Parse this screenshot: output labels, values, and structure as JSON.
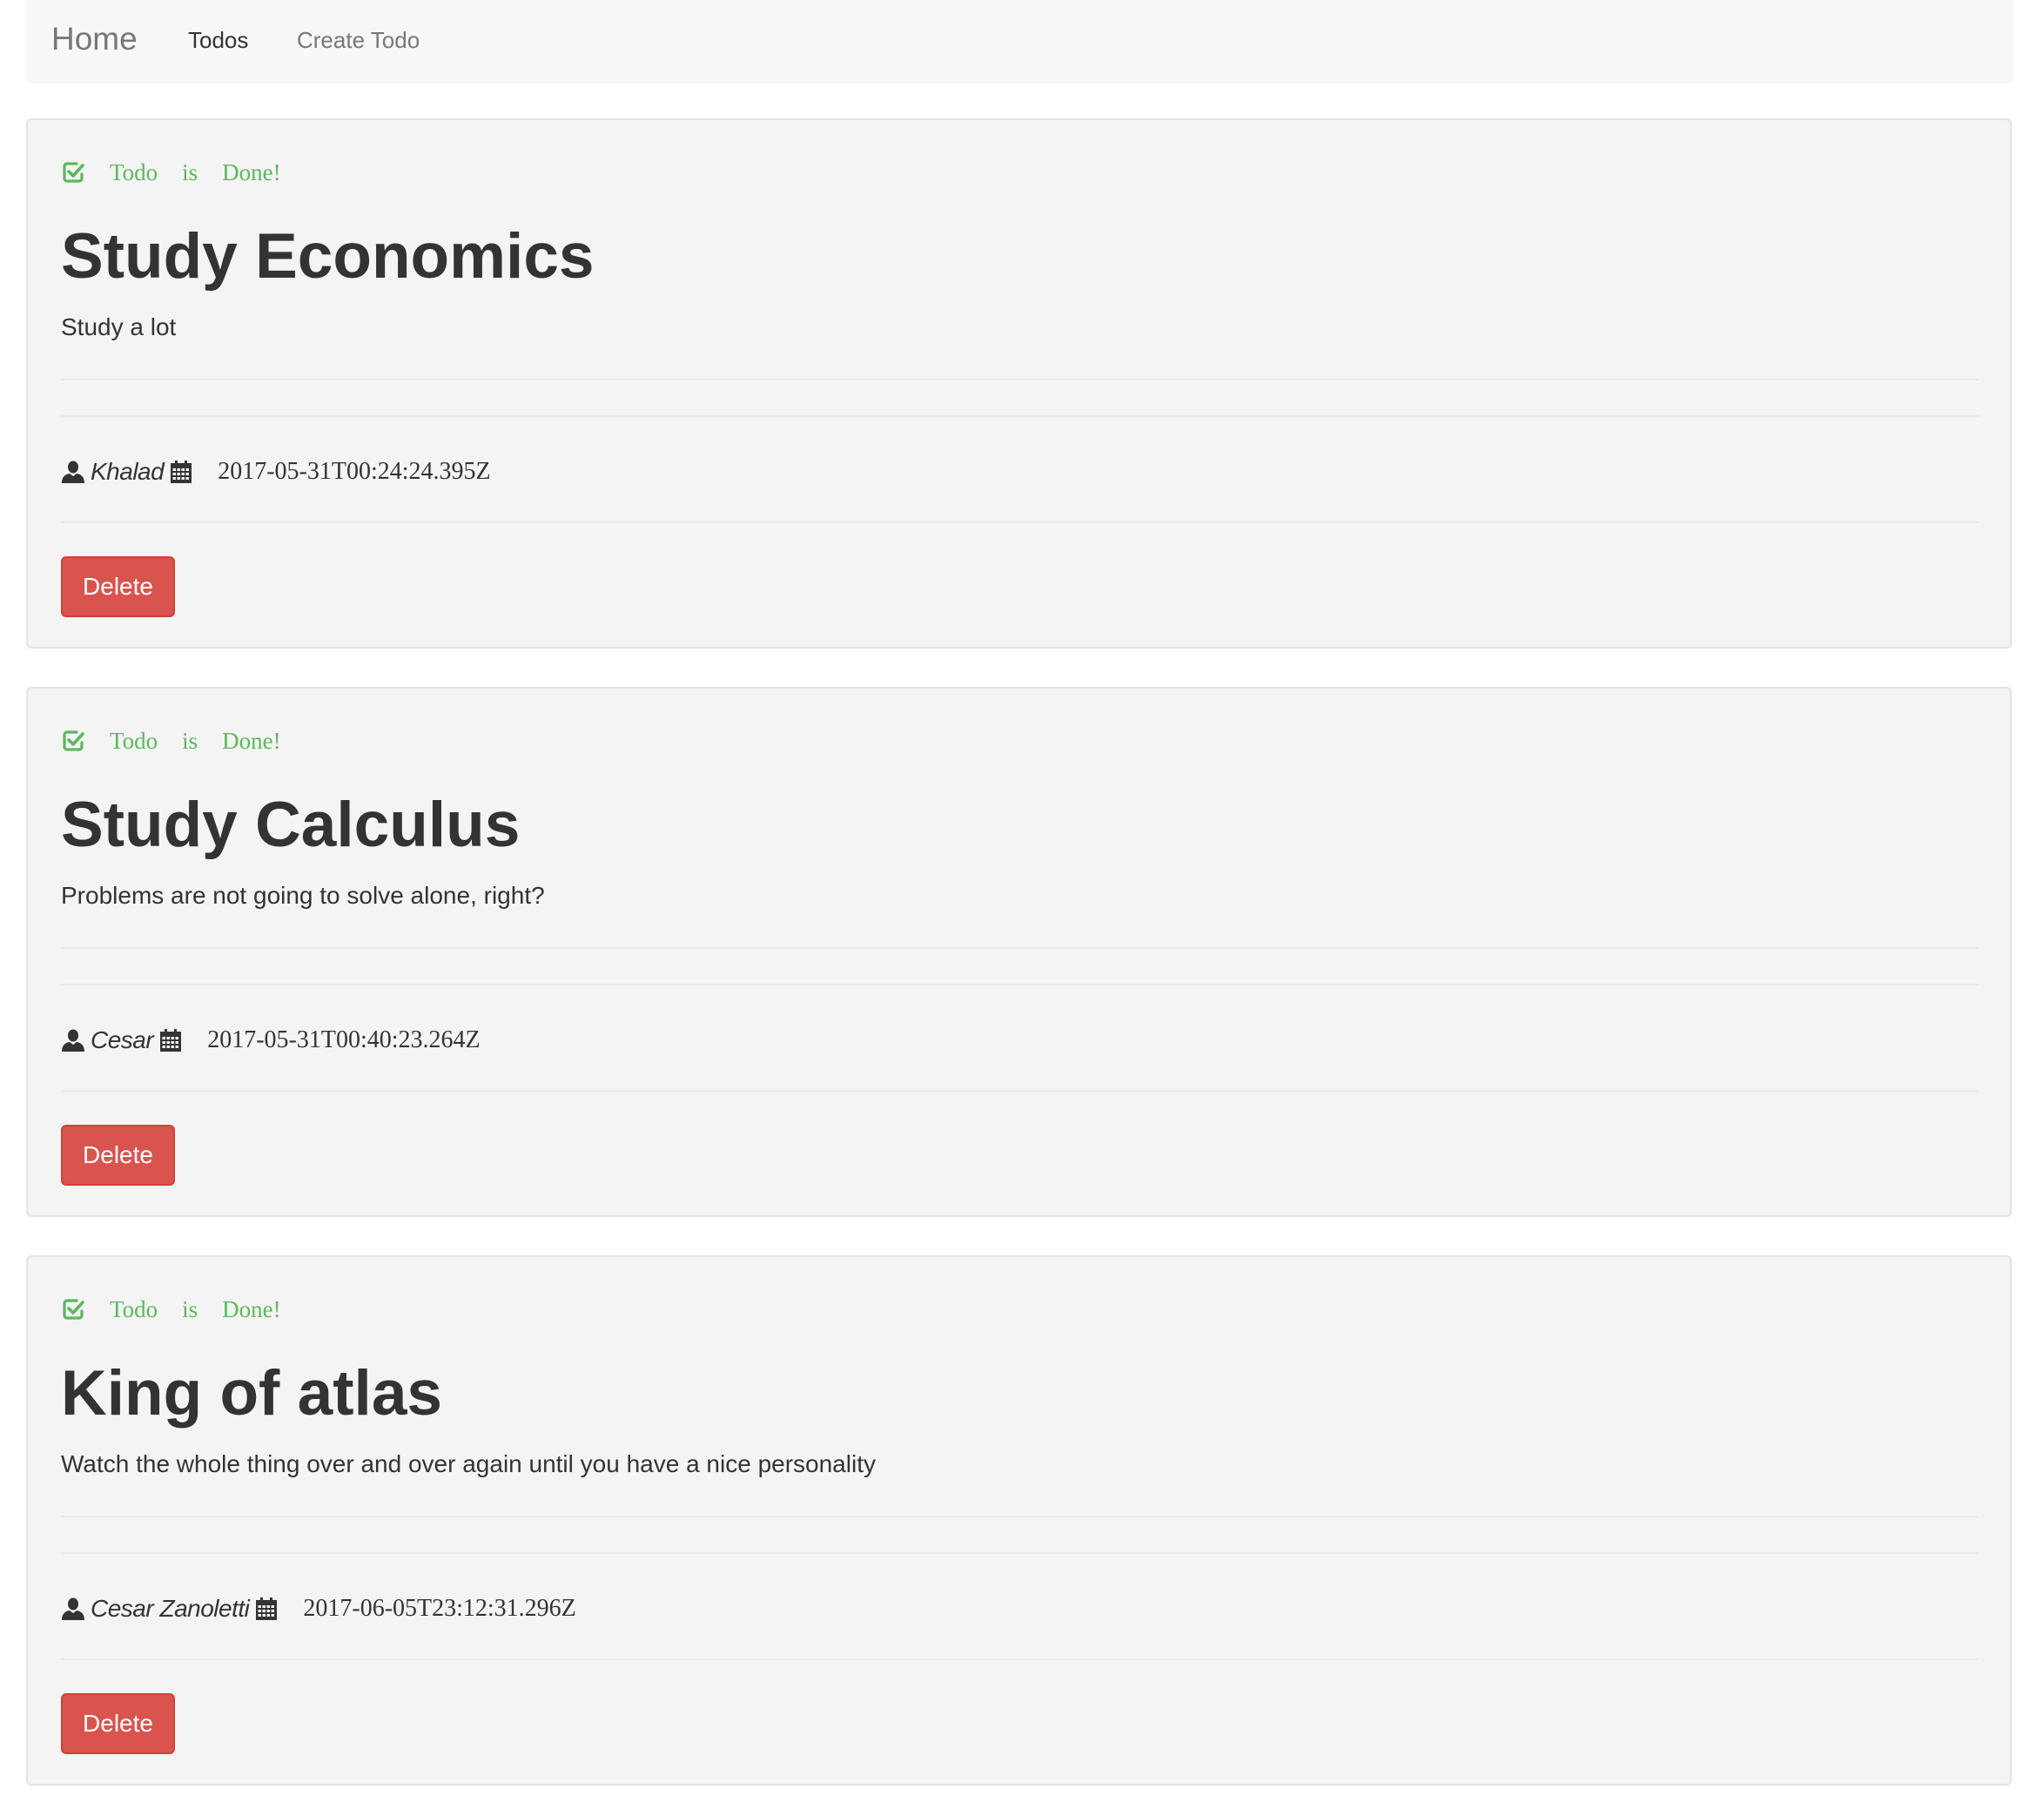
{
  "navbar": {
    "brand": "Home",
    "links": [
      {
        "label": "Todos",
        "active": true
      },
      {
        "label": "Create Todo",
        "active": false
      }
    ]
  },
  "todos": [
    {
      "status_words": [
        "Todo",
        "is",
        "Done!"
      ],
      "title": "Study Economics",
      "description": "Study a lot",
      "author": "Khalad",
      "date": "2017-05-31T00:24:24.395Z",
      "delete_label": "Delete"
    },
    {
      "status_words": [
        "Todo",
        "is",
        "Done!"
      ],
      "title": "Study Calculus",
      "description": "Problems are not going to solve alone, right?",
      "author": "Cesar",
      "date": "2017-05-31T00:40:23.264Z",
      "delete_label": "Delete"
    },
    {
      "status_words": [
        "Todo",
        "is",
        "Done!"
      ],
      "title": "King of atlas",
      "description": "Watch the whole thing over and over again until you have a nice personality",
      "author": "Cesar Zanoletti",
      "date": "2017-06-05T23:12:31.296Z",
      "delete_label": "Delete"
    }
  ],
  "icons": {
    "status": "check-square-icon",
    "author": "user-icon",
    "date": "calendar-icon"
  },
  "colors": {
    "done_green": "#5cb85c",
    "danger_red": "#d9534f",
    "navbar_bg": "#f8f8f8",
    "card_bg": "#f4f4f4"
  }
}
